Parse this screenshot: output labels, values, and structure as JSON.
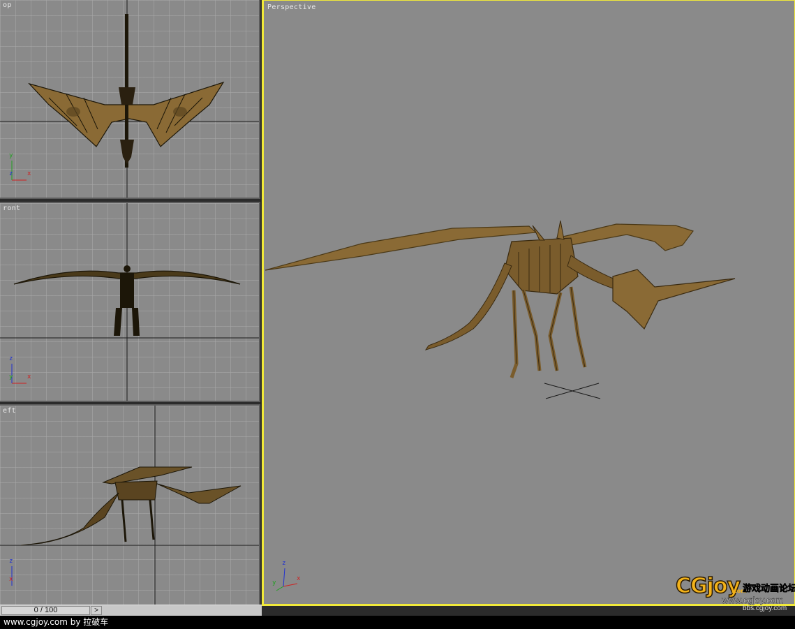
{
  "viewports": {
    "top": {
      "label": "op"
    },
    "front": {
      "label": "ront"
    },
    "left": {
      "label": "eft"
    },
    "perspective": {
      "label": "Perspective"
    }
  },
  "axes": {
    "x": "x",
    "y": "y",
    "z": "z"
  },
  "colors": {
    "viewport_bg": "#8a8a8a",
    "active_border": "#f1ea3a",
    "model": "#8a6a35",
    "wire": "#1c1608",
    "axis_x": "#d02020",
    "axis_y": "#20a020",
    "axis_z": "#2030d0"
  },
  "timeline": {
    "frame": "0 / 100",
    "next_label": ">"
  },
  "credit": "www.cgjoy.com by 拉破车",
  "logo": {
    "brand": "CGjoy",
    "com": ".com",
    "cn_text": "游戏动画论坛",
    "url": "www.cgjoy.com",
    "url2": "bbs.cgjoy.com"
  }
}
